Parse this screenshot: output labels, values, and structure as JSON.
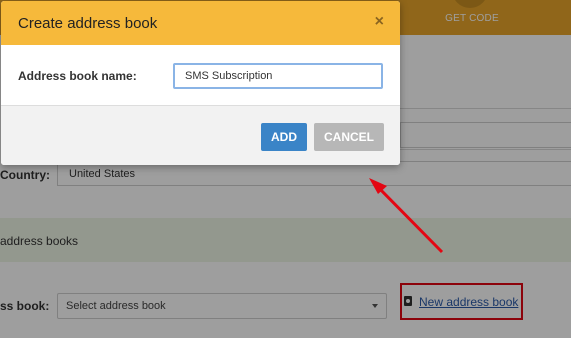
{
  "background": {
    "step_label": "GET CODE",
    "country_label": "Country:",
    "country_value": "United States",
    "address_books_heading": "address books",
    "address_book_label": "ss book:",
    "select_placeholder": "Select address book",
    "new_address_book_link": "New address book",
    "highlight_color": "#e30613"
  },
  "modal": {
    "title": "Create address book",
    "close_label": "×",
    "name_label": "Address book name:",
    "name_value": "SMS Subscription",
    "add_label": "ADD",
    "cancel_label": "CANCEL",
    "header_color": "#f6b93b",
    "add_color": "#3a84c7",
    "cancel_color": "#b7b7b7"
  }
}
